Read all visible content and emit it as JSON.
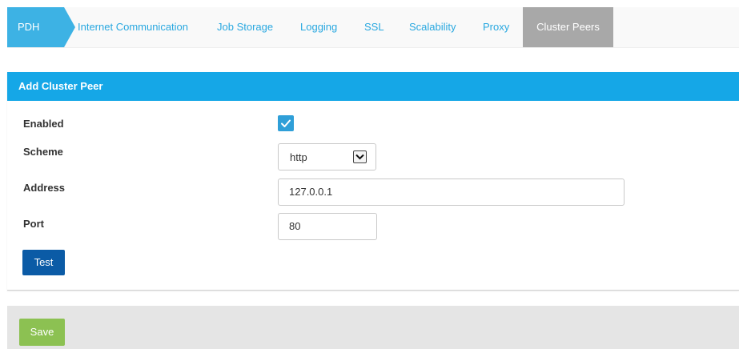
{
  "nav": {
    "tabs": [
      {
        "label": "PDH"
      },
      {
        "label": "Internet Communication"
      },
      {
        "label": "Job Storage"
      },
      {
        "label": "Logging"
      },
      {
        "label": "SSL"
      },
      {
        "label": "Scalability"
      },
      {
        "label": "Proxy"
      },
      {
        "label": "Cluster Peers"
      }
    ],
    "active_tab": "Cluster Peers"
  },
  "panel": {
    "title": "Add Cluster Peer",
    "fields": {
      "enabled": {
        "label": "Enabled",
        "checked": true
      },
      "scheme": {
        "label": "Scheme",
        "value": "http",
        "options": [
          "http"
        ]
      },
      "address": {
        "label": "Address",
        "value": "127.0.0.1"
      },
      "port": {
        "label": "Port",
        "value": "80"
      }
    },
    "test_label": "Test"
  },
  "footer": {
    "save_label": "Save"
  },
  "colors": {
    "accent": "#15a7e7",
    "nav_link": "#29a8e0",
    "active_tab_bg": "#a8a8a8",
    "test_button": "#0b5ba6",
    "save_button": "#8cc152",
    "checkbox": "#2f9fd8"
  },
  "icons": {
    "checkbox": "checkmark-icon",
    "select": "chevron-down-icon"
  }
}
